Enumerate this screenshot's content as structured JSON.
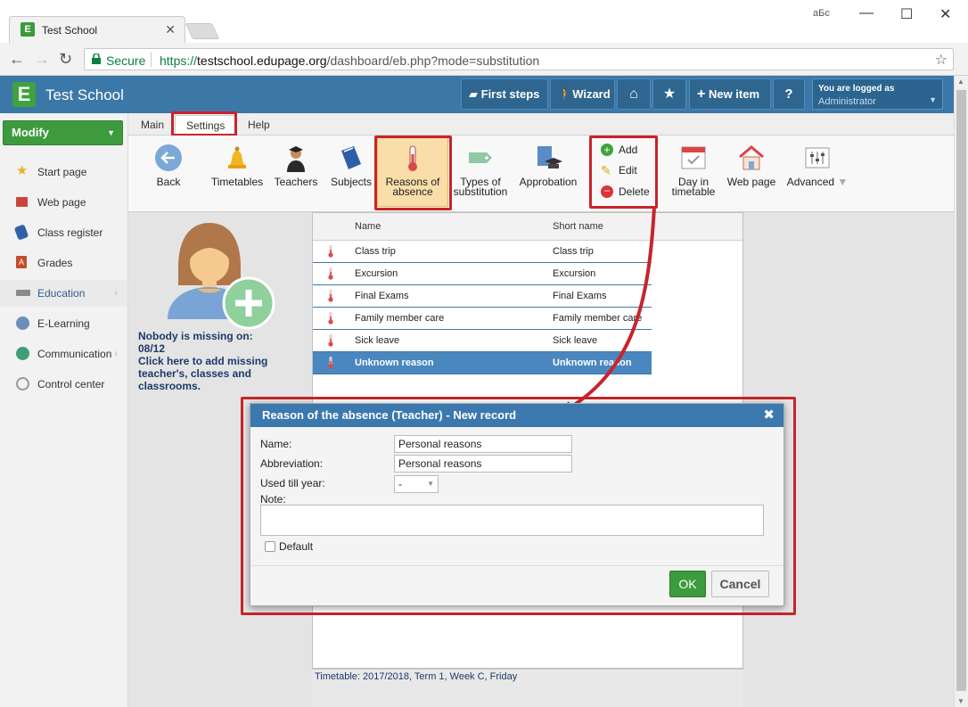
{
  "browser": {
    "tab_title": "Test School",
    "secure_label": "Secure",
    "url_scheme": "https://",
    "url_host": "testschool.edupage.org",
    "url_path": "/dashboard/eb.php?mode=substitution",
    "extension_label": "aБc"
  },
  "header": {
    "school_name": "Test School",
    "buttons": {
      "first_steps": "First steps",
      "wizard": "Wizard",
      "new_item": "New item",
      "help": "?"
    },
    "logged_in_label": "You are logged as",
    "user": "Administrator"
  },
  "sidebar": {
    "modify": "Modify",
    "items": [
      {
        "label": "Start page"
      },
      {
        "label": "Web page"
      },
      {
        "label": "Class register"
      },
      {
        "label": "Grades"
      },
      {
        "label": "Education"
      },
      {
        "label": "E-Learning"
      },
      {
        "label": "Communication"
      },
      {
        "label": "Control center"
      }
    ]
  },
  "app_tabs": [
    "Main",
    "Settings",
    "Help"
  ],
  "ribbon": {
    "back": "Back",
    "timetables": "Timetables",
    "teachers": "Teachers",
    "subjects": "Subjects",
    "reasons_1": "Reasons of",
    "reasons_2": "absence",
    "types_1": "Types of",
    "types_2": "substitution",
    "approbation": "Approbation",
    "add": "Add",
    "edit": "Edit",
    "delete": "Delete",
    "day_1": "Day in",
    "day_2": "timetable",
    "web_page": "Web page",
    "advanced": "Advanced"
  },
  "info": {
    "line1": "Nobody is missing on:",
    "line2": "08/12",
    "line3": "Click here to add missing teacher's, classes and classrooms."
  },
  "grid": {
    "columns": [
      "Name",
      "Short name"
    ],
    "rows": [
      {
        "name": "Class trip",
        "short": "Class trip"
      },
      {
        "name": "Excursion",
        "short": "Excursion"
      },
      {
        "name": "Final Exams",
        "short": "Final Exams"
      },
      {
        "name": "Family member care",
        "short": "Family member care"
      },
      {
        "name": "Sick leave",
        "short": "Sick leave"
      },
      {
        "name": "Unknown reason",
        "short": "Unknown reason"
      }
    ],
    "selected_index": 5
  },
  "status": "Timetable: 2017/2018, Term 1, Week C, Friday",
  "dialog": {
    "title": "Reason of the absence (Teacher) - New record",
    "name_label": "Name:",
    "name_value": "Personal reasons",
    "abbr_label": "Abbreviation:",
    "abbr_value": "Personal reasons",
    "used_label": "Used till year:",
    "used_value": "-",
    "note_label": "Note:",
    "default_label": "Default",
    "ok": "OK",
    "cancel": "Cancel"
  },
  "colors": {
    "header_blue": "#3c78a7",
    "accent_green": "#3d9b3d",
    "highlight_red": "#c8242b",
    "selected_row": "#4a87bf"
  }
}
